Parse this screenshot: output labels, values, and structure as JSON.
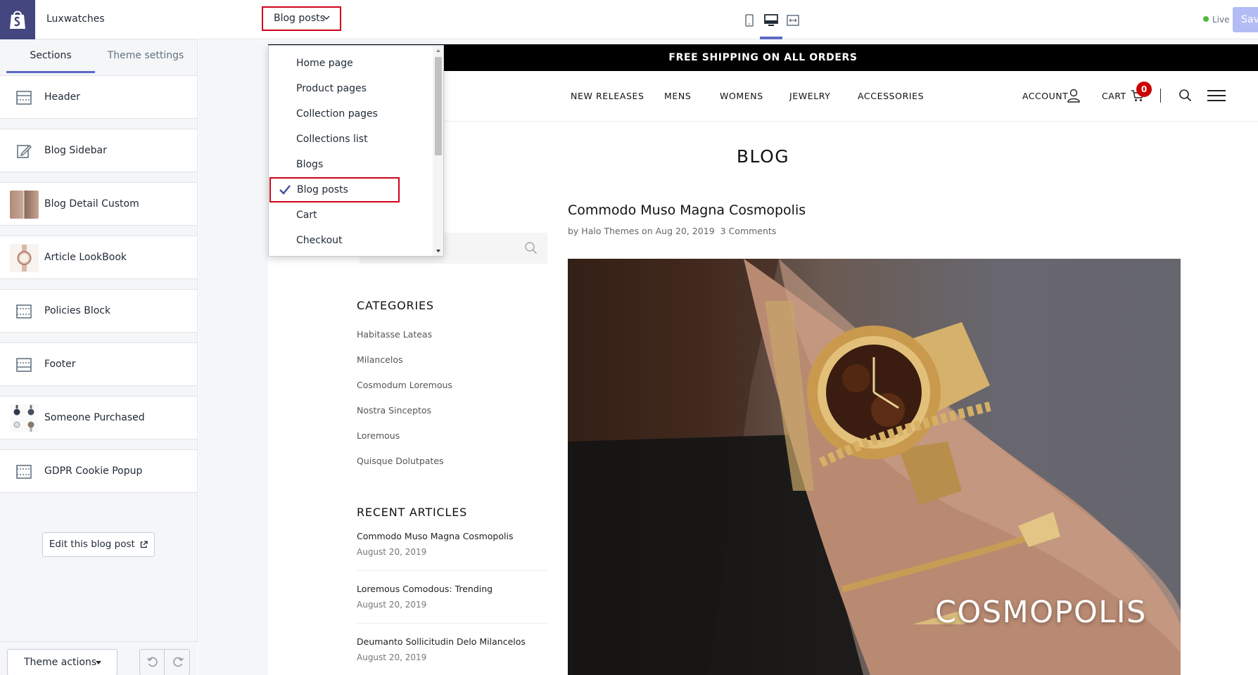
{
  "brand": {
    "store_name": "Luxwatches",
    "logo_icon": "shopify-bag-icon",
    "logo_color": "#43467f"
  },
  "sidebar": {
    "tabs": [
      {
        "label": "Sections",
        "active": true
      },
      {
        "label": "Theme settings",
        "active": false
      }
    ],
    "sections": [
      {
        "label": "Header",
        "icon": "layout-header-icon"
      },
      {
        "label": "Blog Sidebar",
        "icon": "edit-note-icon"
      },
      {
        "label": "Blog Detail Custom",
        "icon": "image-thumbnail"
      },
      {
        "label": "Article LookBook",
        "icon": "watch-thumbnail"
      },
      {
        "label": "Policies Block",
        "icon": "layout-block-icon"
      },
      {
        "label": "Footer",
        "icon": "layout-footer-icon"
      },
      {
        "label": "Someone Purchased",
        "icon": "watches-thumbnail"
      },
      {
        "label": "GDPR Cookie Popup",
        "icon": "layout-block-icon"
      }
    ],
    "edit_button": "Edit this blog post",
    "theme_actions": "Theme actions"
  },
  "topbar": {
    "page_select": "Blog posts",
    "devices": [
      "mobile-icon",
      "desktop-icon",
      "fullscreen-icon"
    ],
    "active_device": "desktop",
    "status": "Live",
    "save_label": "Sav",
    "accent": "#5c6ac4",
    "highlight": "#d0021b"
  },
  "dropdown": {
    "items": [
      "Home page",
      "Product pages",
      "Collection pages",
      "Collections list",
      "Blogs",
      "Blog posts",
      "Cart",
      "Checkout"
    ],
    "selected": "Blog posts"
  },
  "store": {
    "announcement": "FREE SHIPPING ON ALL ORDERS",
    "nav": [
      "NEW RELEASES",
      "MENS",
      "WOMENS",
      "JEWELRY",
      "ACCESSORIES"
    ],
    "account": "ACCOUNT",
    "cart": "CART",
    "cart_count": "0",
    "page_title": "BLOG",
    "categories_heading": "CATEGORIES",
    "categories": [
      "Habitasse Lateas",
      "Milancelos",
      "Cosmodum Loremous",
      "Nostra Sinceptos",
      "Loremous",
      "Quisque Dolutpates"
    ],
    "recent_heading": "RECENT ARTICLES",
    "recent": [
      {
        "title": "Commodo Muso Magna Cosmopolis",
        "date": "August 20, 2019"
      },
      {
        "title": "Loremous Comodous: Trending",
        "date": "August 20, 2019"
      },
      {
        "title": "Deumanto Sollicitudin Delo Milancelos",
        "date": "August 20, 2019"
      }
    ],
    "post": {
      "title": "Commodo Muso Magna Cosmopolis",
      "by": "by Halo Themes on Aug 20, 2019",
      "comments": "3 Comments",
      "hero_text": "COSMOPOLIS"
    }
  }
}
